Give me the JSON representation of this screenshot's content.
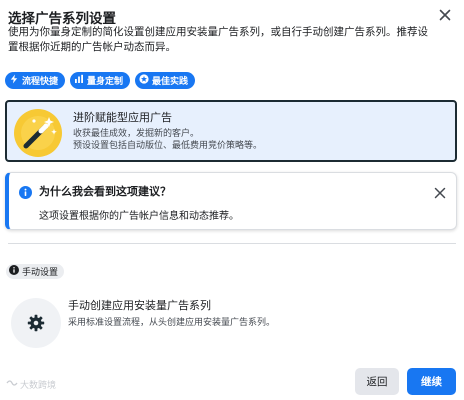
{
  "dialog": {
    "title": "选择广告系列设置",
    "description": "使用为你量身定制的简化设置创建应用安装量广告系列，或自行手动创建广告系列。推荐设置根据你近期的广告帐户动态而异。"
  },
  "chips": [
    {
      "label": "流程快捷",
      "icon": "lightning-icon"
    },
    {
      "label": "量身定制",
      "icon": "bar-chart-icon"
    },
    {
      "label": "最佳实践",
      "icon": "star-icon"
    }
  ],
  "advanced_option": {
    "title": "进阶赋能型应用广告",
    "desc_line1": "收获最佳成效，发掘新的客户。",
    "desc_line2": "预设设置包括自动版位、最低费用竞价策略等。"
  },
  "notice": {
    "title": "为什么我会看到这项建议？",
    "body": "这项设置根据你的广告帐户信息和动态推荐。"
  },
  "manual_badge": {
    "label": "手动设置"
  },
  "manual_option": {
    "title": "手动创建应用安装量广告系列",
    "desc": "采用标准设置流程，从头创建应用安装量广告系列。"
  },
  "watermark": {
    "text": "大数跨境"
  },
  "footer": {
    "back_label": "返回",
    "continue_label": "继续"
  },
  "colors": {
    "accent": "#1877f2",
    "selected_bg": "#e7f0fd",
    "secondary_button": "#e4e6eb"
  }
}
